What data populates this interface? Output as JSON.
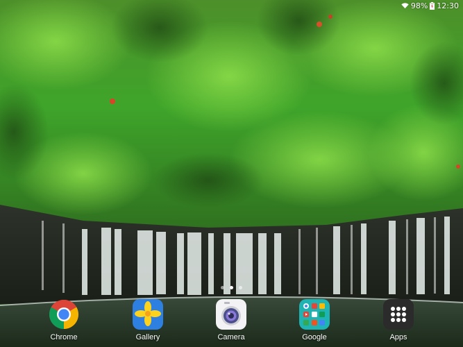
{
  "status_bar": {
    "battery_percent": "98%",
    "time": "12:30",
    "icons": [
      "wifi-icon",
      "battery-charging-icon"
    ]
  },
  "home": {
    "page_count": 3,
    "active_page": 1
  },
  "dock": {
    "apps": [
      {
        "label": "Chrome",
        "icon": "chrome-icon"
      },
      {
        "label": "Gallery",
        "icon": "gallery-icon"
      },
      {
        "label": "Camera",
        "icon": "camera-icon"
      },
      {
        "label": "Google",
        "icon": "google-folder-icon"
      },
      {
        "label": "Apps",
        "icon": "apps-grid-icon"
      }
    ]
  },
  "colors": {
    "chrome_red": "#db4437",
    "chrome_yellow": "#f4b400",
    "chrome_green": "#0f9d58",
    "chrome_blue": "#4285f4",
    "gallery_yellow": "#fbd31f",
    "gallery_blue": "#2d7fe0",
    "google_folder_teal": "#1fb4b4",
    "apps_dark": "#2b2b2b"
  }
}
